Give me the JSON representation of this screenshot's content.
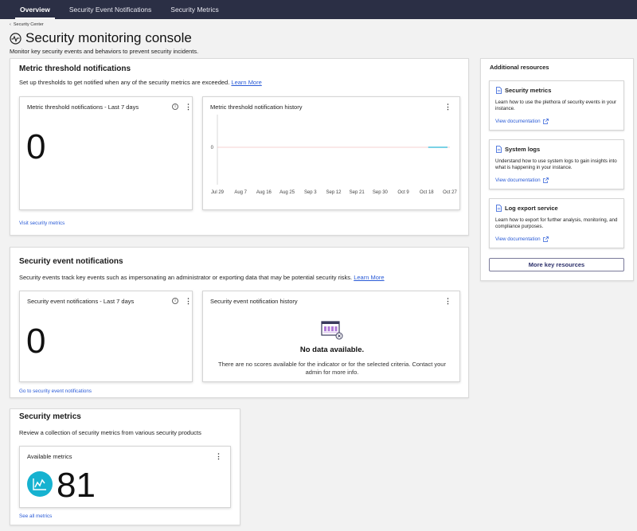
{
  "nav": {
    "tabs": [
      {
        "label": "Overview",
        "active": true
      },
      {
        "label": "Security Event Notifications",
        "active": false
      },
      {
        "label": "Security Metrics",
        "active": false
      }
    ]
  },
  "breadcrumb": {
    "label": "Security Center"
  },
  "page": {
    "title": "Security monitoring console",
    "subtitle": "Monitor key security events and behaviors to prevent security incidents."
  },
  "threshold": {
    "heading": "Metric threshold notifications",
    "description": "Set up thresholds to get notified when any of the security metrics are exceeded.",
    "learn_more": "Learn More",
    "count_tile": {
      "title": "Metric threshold notifications - Last 7 days",
      "value": "0"
    },
    "history_tile": {
      "title": "Metric threshold notification history",
      "y_tick": "0",
      "x_ticks": [
        "Jul 29",
        "Aug 7",
        "Aug 16",
        "Aug 25",
        "Sep 3",
        "Sep 12",
        "Sep 21",
        "Sep 30",
        "Oct 9",
        "Oct 18",
        "Oct 27"
      ]
    },
    "footer_link": "Visit security metrics"
  },
  "events": {
    "heading": "Security event notifications",
    "description": "Security events track key events such as impersonating an administrator or exporting data that may be potential security risks.",
    "learn_more": "Learn More",
    "count_tile": {
      "title": "Security event notifications - Last 7 days",
      "value": "0"
    },
    "history_tile": {
      "title": "Security event notification history",
      "no_data_title": "No data available.",
      "no_data_message": "There are no scores available for the indicator or for the selected criteria. Contact your admin for more info."
    },
    "footer_link": "Go to security event notifications"
  },
  "metrics": {
    "heading": "Security metrics",
    "description": "Review a collection of security metrics from various security products",
    "tile": {
      "title": "Available metrics",
      "value": "81"
    },
    "footer_link": "See all metrics"
  },
  "resources": {
    "heading": "Additional resources",
    "items": [
      {
        "title": "Security metrics",
        "description": "Learn how to use the plethora of security events in your instance.",
        "link": "View documentation"
      },
      {
        "title": "System logs",
        "description": "Understand how to use system logs to gain insights into what is happening in your instance.",
        "link": "View documentation"
      },
      {
        "title": "Log export service",
        "description": "Learn how to export for further analysis, monitoring, and compliance purposes.",
        "link": "View documentation"
      }
    ],
    "more_button": "More key resources"
  },
  "chart_data": {
    "type": "line",
    "title": "Metric threshold notification history",
    "categories": [
      "Jul 29",
      "Aug 7",
      "Aug 16",
      "Aug 25",
      "Sep 3",
      "Sep 12",
      "Sep 21",
      "Sep 30",
      "Oct 9",
      "Oct 18",
      "Oct 27"
    ],
    "series": [
      {
        "values": [
          0,
          0
        ]
      }
    ],
    "series_x_range": [
      "Oct 18",
      "Oct 27"
    ],
    "y_ticks": [
      0
    ],
    "grid": false,
    "colors": {
      "line": "#2bb6d8",
      "baseline": "#f0c0c0"
    }
  }
}
